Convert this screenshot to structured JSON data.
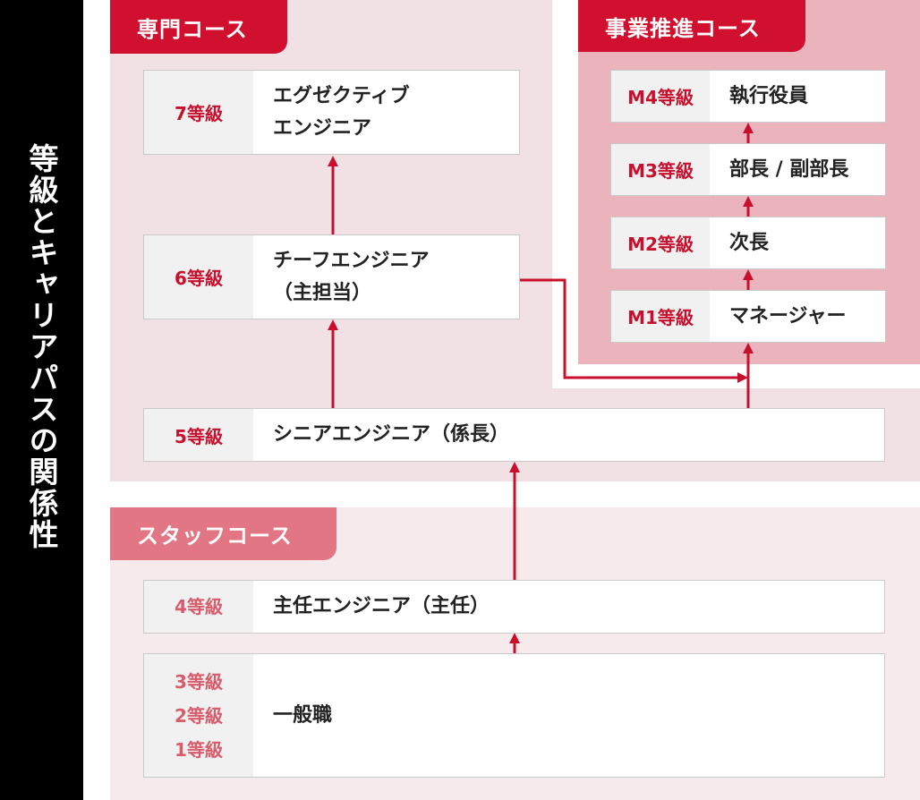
{
  "sidebar": {
    "title": "等級とキャリアパスの関係性"
  },
  "courses": {
    "expert": "専門コース",
    "management": "事業推進コース",
    "staff": "スタッフコース"
  },
  "expert_levels": [
    {
      "grade": "7等級",
      "title_line1": "エグゼクティブ",
      "title_line2": "エンジニア"
    },
    {
      "grade": "6等級",
      "title_line1": "チーフエンジニア",
      "title_line2": "（主担当）"
    },
    {
      "grade": "5等級",
      "title_line1": "シニアエンジニア（係長）",
      "title_line2": ""
    }
  ],
  "management_levels": [
    {
      "grade": "M4等級",
      "title": "執行役員"
    },
    {
      "grade": "M3等級",
      "title": "部長 / 副部長"
    },
    {
      "grade": "M2等級",
      "title": "次長"
    },
    {
      "grade": "M1等級",
      "title": "マネージャー"
    }
  ],
  "staff_levels": [
    {
      "grade": "4等級",
      "title": "主任エンジニア（主任）"
    },
    {
      "grades": [
        "3等級",
        "2等級",
        "1等級"
      ],
      "title": "一般職"
    }
  ],
  "colors": {
    "accent": "#c8102e",
    "tab_expert": "#d0102e",
    "tab_staff": "#e37684",
    "zone_expert": "#f2e1e4",
    "zone_management": "#ebb3bc",
    "zone_staff": "#f6eaec",
    "sidebar": "#000000"
  }
}
